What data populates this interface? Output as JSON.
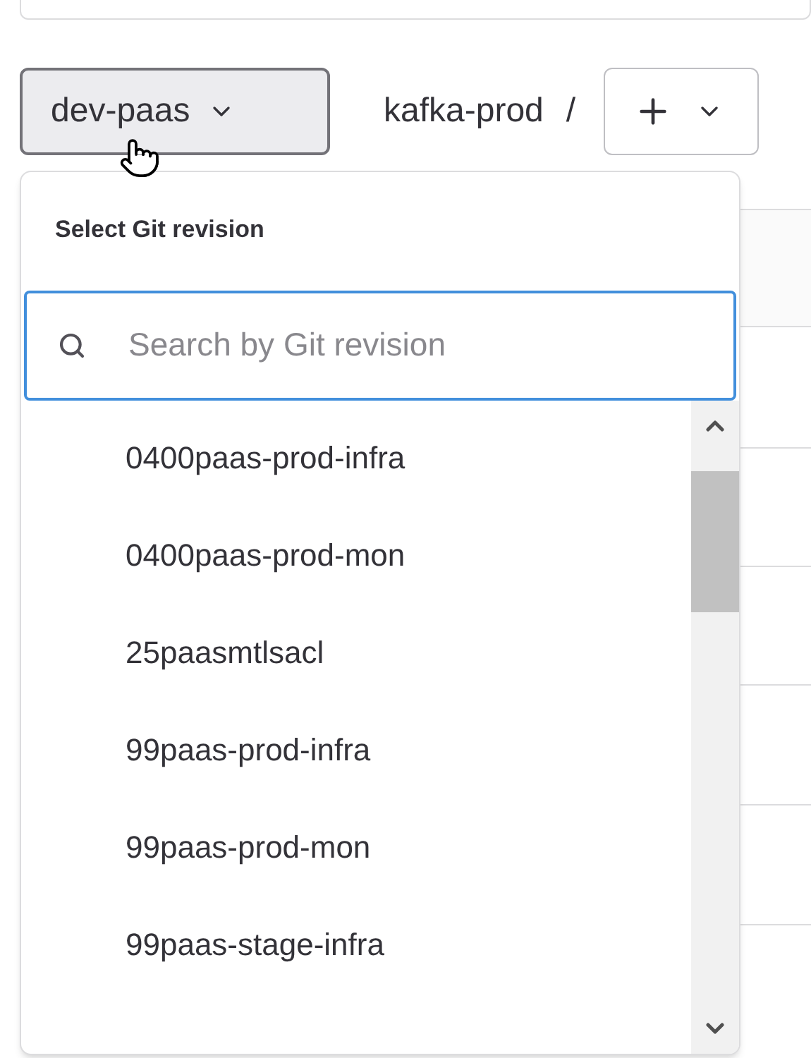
{
  "revision_button": {
    "label": "dev-paas"
  },
  "breadcrumb": {
    "project": "kafka-prod",
    "separator": "/"
  },
  "dropdown": {
    "title": "Select Git revision",
    "search": {
      "placeholder": "Search by Git revision"
    },
    "items": [
      {
        "label": "0400paas-prod-infra"
      },
      {
        "label": "0400paas-prod-mon"
      },
      {
        "label": "25paasmtlsacl"
      },
      {
        "label": "99paas-prod-infra"
      },
      {
        "label": "99paas-prod-mon"
      },
      {
        "label": "99paas-stage-infra"
      }
    ]
  }
}
